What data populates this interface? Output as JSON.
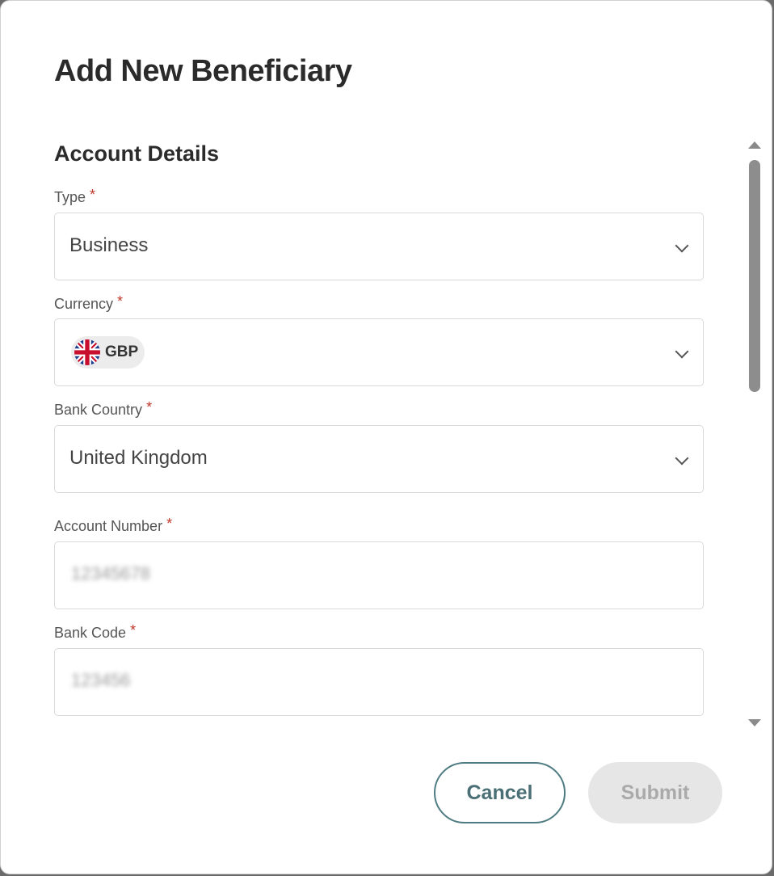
{
  "dialog": {
    "title": "Add New Beneficiary"
  },
  "section": {
    "title": "Account Details"
  },
  "fields": {
    "type": {
      "label": "Type",
      "required_mark": "*",
      "value": "Business"
    },
    "currency": {
      "label": "Currency",
      "required_mark": "*",
      "value": "GBP",
      "flag_icon": "uk-flag-icon"
    },
    "bank_country": {
      "label": "Bank Country",
      "required_mark": "*",
      "value": "United Kingdom"
    },
    "account_number": {
      "label": "Account Number",
      "required_mark": "*",
      "value": "12345678"
    },
    "bank_code": {
      "label": "Bank Code",
      "required_mark": "*",
      "value": "123456"
    }
  },
  "buttons": {
    "cancel": "Cancel",
    "submit": "Submit"
  },
  "colors": {
    "accent": "#4f7b82",
    "required": "#c0392b",
    "disabled_bg": "#e6e6e6"
  }
}
